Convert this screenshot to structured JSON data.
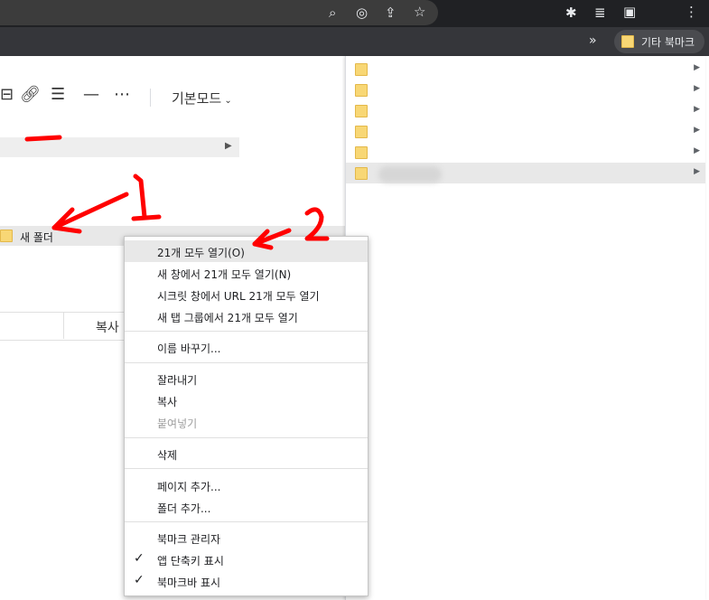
{
  "chrome": {
    "toolbar_icons": [
      "zoom-icon",
      "eye-off-icon",
      "share-icon",
      "star-icon",
      "puzzle-icon",
      "media-icon",
      "sidepanel-icon",
      "kebab-icon"
    ],
    "more_bookmarks": "»",
    "other_bookmarks_label": "기타 북마크"
  },
  "page": {
    "mode_label": "기본모드",
    "grid_copy_label": "복사"
  },
  "bookmark_bar_item": {
    "label": "새 폴더"
  },
  "context_menu": {
    "items": [
      {
        "label": "21개 모두 열기(O)"
      },
      {
        "label": "새 창에서 21개 모두 열기(N)"
      },
      {
        "label": "시크릿 창에서 URL 21개 모두 열기"
      },
      {
        "label": "새 탭 그룹에서 21개 모두 열기"
      },
      {
        "label": "이름 바꾸기..."
      },
      {
        "label": "잘라내기"
      },
      {
        "label": "복사"
      },
      {
        "label": "붙여넣기"
      },
      {
        "label": "삭제"
      },
      {
        "label": "페이지 추가..."
      },
      {
        "label": "폴더 추가..."
      },
      {
        "label": "북마크 관리자"
      },
      {
        "label": "앱 단축키 표시"
      },
      {
        "label": "북마크바 표시"
      }
    ]
  },
  "annotations": {
    "arrow_1": "1",
    "arrow_2": "2"
  },
  "colors": {
    "chrome_dark": "#202124",
    "bookmark_bar": "#35363a",
    "annotation_red": "#ff0000",
    "folder_yellow": "#f8d775"
  }
}
